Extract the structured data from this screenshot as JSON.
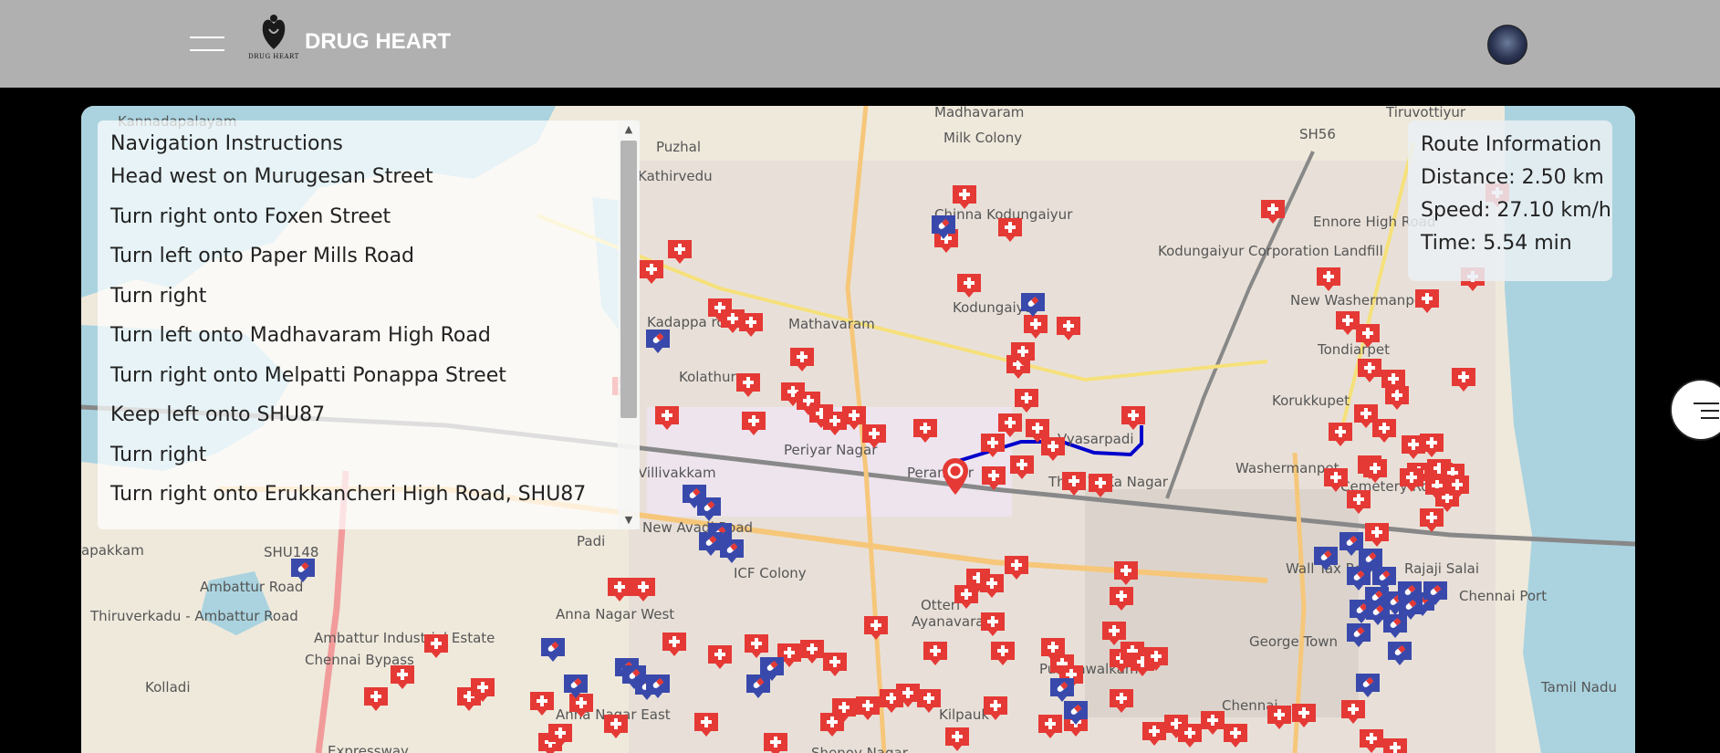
{
  "app": {
    "brand_name": "DRUG HEART",
    "logo_text": "DRUG HEART",
    "header_bg": "#b0b0b0"
  },
  "icons": {
    "menu": "hamburger-icon",
    "logo": "heart-hands-logo",
    "avatar": "user-avatar",
    "side_toggle": "route-list-icon",
    "hospital_marker": "red-plus-marker",
    "pharmacy_marker": "blue-pill-marker",
    "location_marker": "red-location-pin"
  },
  "navigation": {
    "title": "Navigation Instructions",
    "steps": [
      "Head west on Murugesan Street",
      "Turn right onto Foxen Street",
      "Turn left onto Paper Mills Road",
      "Turn right",
      "Turn left onto Madhavaram High Road",
      "Turn right onto Melpatti Ponappa Street",
      "Keep left onto SHU87",
      "Turn right",
      "Turn right onto Erukkancheri High Road, SHU87"
    ]
  },
  "route_info": {
    "title": "Route Information",
    "distance": "Distance: 2.50 km",
    "speed": "Speed: 27.10 km/h",
    "time": "Time: 5.54 min"
  },
  "map_labels": [
    "Kannadapalayam",
    "Madhavaram",
    "Milk Colony",
    "SH56",
    "Puzhal",
    "Kathirvedu",
    "Chinna Kodungaiyur",
    "Kodungaiyur Corporation Landfill",
    "New Washermanpet",
    "Kodungaiyur",
    "Mathavaram",
    "Kolathur",
    "Tondiarpet",
    "Korukkupet",
    "Vyasarpadi",
    "Villivakkam",
    "Periyar Nagar",
    "Perambur",
    "Thiru Vi Ka Nagar",
    "Washermanpet",
    "Padi",
    "SHU148",
    "ICF Colony",
    "Otteri",
    "Anna Nagar West",
    "Ayanavaram",
    "Ambattur Industrial Estate",
    "Kolladi",
    "Anna Nagar East",
    "Purasawalkam",
    "George Town",
    "Chennai Port",
    "Kilpauk",
    "Shenoy Nagar",
    "Chennai",
    "Ennore High Road",
    "Wall Tax Road",
    "Rajaji Salai",
    "Tamil Nadu",
    "Chennai Bypass",
    "Ambattur Road",
    "Kadappa road",
    "New Avadi Road",
    "Cemetery Road",
    "Thiruverkadu - Ambattur Road",
    "apakkam",
    "Expressway",
    "Tiruvottiyur"
  ],
  "colors": {
    "hospital": "#e53935",
    "pharmacy": "#3949ab",
    "route": "#0000cc",
    "water": "#aad3df",
    "land": "#efe9dc"
  }
}
